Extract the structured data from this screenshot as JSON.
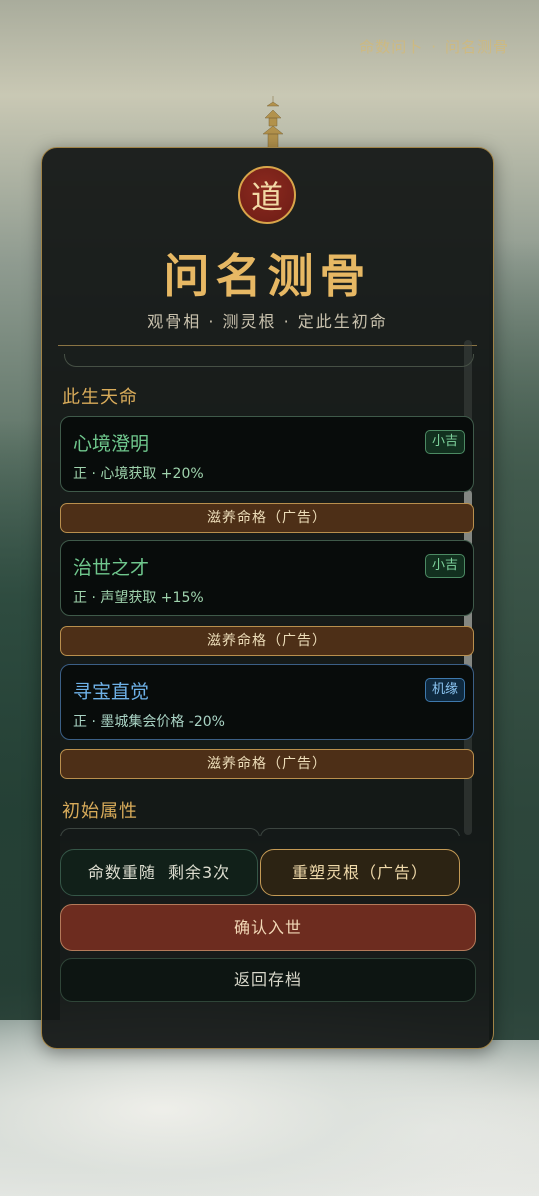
{
  "breadcrumb": {
    "parent": "命数问卜",
    "current": "问名测骨"
  },
  "header": {
    "seal_glyph": "道",
    "title": "问名测骨",
    "subtitle": "观骨相 · 测灵根 · 定此生初命"
  },
  "destiny": {
    "section_title": "此生天命",
    "traits": [
      {
        "name": "心境澄明",
        "badge": "小吉",
        "desc": "正 · 心境获取 +20%",
        "tone": "green"
      },
      {
        "name": "治世之才",
        "badge": "小吉",
        "desc": "正 · 声望获取 +15%",
        "tone": "green"
      },
      {
        "name": "寻宝直觉",
        "badge": "机缘",
        "desc": "正 · 墨城集会价格 -20%",
        "tone": "blue"
      }
    ],
    "ad_button_label": "滋养命格（广告）"
  },
  "attributes": {
    "section_title": "初始属性"
  },
  "actions": {
    "reroll_label": "命数重随",
    "reroll_remaining": "剩余3次",
    "reshape_label": "重塑灵根（广告）",
    "confirm_label": "确认入世",
    "back_label": "返回存档"
  },
  "colors": {
    "accent_gold": "#e7b864",
    "seal_red": "#8d2a1f",
    "green_tag": "#7ed29c",
    "blue_tag": "#8cc6f3",
    "confirm_red": "#6d2c1f"
  }
}
